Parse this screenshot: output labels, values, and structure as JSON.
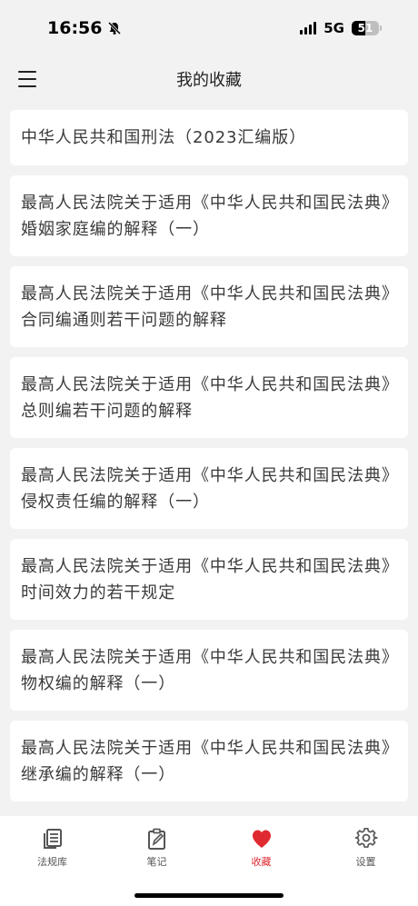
{
  "status_bar": {
    "time": "16:56",
    "network": "5G",
    "battery_level": "51",
    "battery_fraction": 0.51
  },
  "header": {
    "title": "我的收藏",
    "menu_icon": "menu-icon"
  },
  "favorites": [
    {
      "title": "中华人民共和国刑法（2023汇编版）"
    },
    {
      "title": "最高人民法院关于适用《中华人民共和国民法典》婚姻家庭编的解释（一）"
    },
    {
      "title": "最高人民法院关于适用《中华人民共和国民法典》合同编通则若干问题的解释"
    },
    {
      "title": "最高人民法院关于适用《中华人民共和国民法典》总则编若干问题的解释"
    },
    {
      "title": "最高人民法院关于适用《中华人民共和国民法典》侵权责任编的解释（一）"
    },
    {
      "title": "最高人民法院关于适用《中华人民共和国民法典》时间效力的若干规定"
    },
    {
      "title": "最高人民法院关于适用《中华人民共和国民法典》物权编的解释（一）"
    },
    {
      "title": "最高人民法院关于适用《中华人民共和国民法典》继承编的解释（一）"
    }
  ],
  "tab_bar": {
    "active_color": "#e02a32",
    "tabs": [
      {
        "label": "法规库",
        "icon": "law-library-icon"
      },
      {
        "label": "笔记",
        "icon": "notes-icon"
      },
      {
        "label": "收藏",
        "icon": "heart-icon",
        "active": true
      },
      {
        "label": "设置",
        "icon": "gear-icon"
      }
    ]
  }
}
